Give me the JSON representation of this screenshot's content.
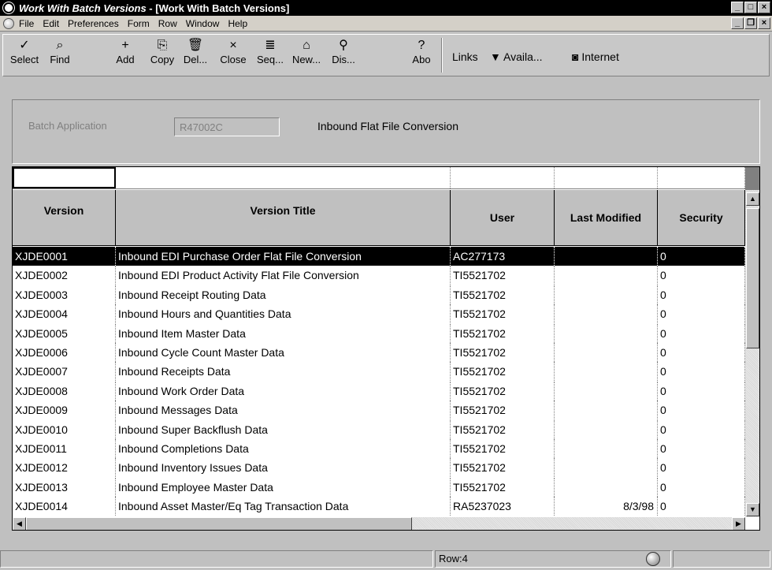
{
  "window": {
    "title_italic": "Work With Batch Versions",
    "title_rest": " - [Work With Batch Versions]"
  },
  "menu": [
    "File",
    "Edit",
    "Preferences",
    "Form",
    "Row",
    "Window",
    "Help"
  ],
  "toolbar": {
    "buttons": [
      {
        "label": "Select",
        "icon": "check-icon"
      },
      {
        "label": "Find",
        "icon": "find-icon"
      },
      {
        "label": "Add",
        "icon": "add-icon"
      },
      {
        "label": "Copy",
        "icon": "copy-icon"
      },
      {
        "label": "Del...",
        "icon": "delete-icon"
      },
      {
        "label": "Close",
        "icon": "close-icon"
      },
      {
        "label": "Seq...",
        "icon": "sequence-icon"
      },
      {
        "label": "New...",
        "icon": "new-icon"
      },
      {
        "label": "Dis...",
        "icon": "display-icon"
      },
      {
        "label": "Abo",
        "icon": "about-icon"
      }
    ],
    "links_label": "Links",
    "available_label": "Availa...",
    "internet_label": "Internet"
  },
  "form": {
    "batch_app_label": "Batch Application",
    "batch_app_value": "R47002C",
    "batch_app_desc": "Inbound Flat File Conversion"
  },
  "grid": {
    "headers": {
      "version": "Version",
      "title": "Version Title",
      "user": "User",
      "last_modified": "Last Modified",
      "security": "Security"
    },
    "rows": [
      {
        "version": "XJDE0001",
        "title": "Inbound EDI Purchase Order Flat File Conversion",
        "user": "AC277173",
        "last_modified": "",
        "security": "0"
      },
      {
        "version": "XJDE0002",
        "title": "Inbound EDI Product Activity Flat File Conversion",
        "user": "TI5521702",
        "last_modified": "",
        "security": "0"
      },
      {
        "version": "XJDE0003",
        "title": "Inbound Receipt Routing Data",
        "user": "TI5521702",
        "last_modified": "",
        "security": "0"
      },
      {
        "version": "XJDE0004",
        "title": "Inbound Hours and Quantities Data",
        "user": "TI5521702",
        "last_modified": "",
        "security": "0"
      },
      {
        "version": "XJDE0005",
        "title": "Inbound Item Master Data",
        "user": "TI5521702",
        "last_modified": "",
        "security": "0"
      },
      {
        "version": "XJDE0006",
        "title": "Inbound Cycle Count Master Data",
        "user": "TI5521702",
        "last_modified": "",
        "security": "0"
      },
      {
        "version": "XJDE0007",
        "title": "Inbound Receipts Data",
        "user": "TI5521702",
        "last_modified": "",
        "security": "0"
      },
      {
        "version": "XJDE0008",
        "title": "Inbound Work Order Data",
        "user": "TI5521702",
        "last_modified": "",
        "security": "0"
      },
      {
        "version": "XJDE0009",
        "title": "Inbound Messages Data",
        "user": "TI5521702",
        "last_modified": "",
        "security": "0"
      },
      {
        "version": "XJDE0010",
        "title": "Inbound Super Backflush Data",
        "user": "TI5521702",
        "last_modified": "",
        "security": "0"
      },
      {
        "version": "XJDE0011",
        "title": "Inbound Completions Data",
        "user": "TI5521702",
        "last_modified": "",
        "security": "0"
      },
      {
        "version": "XJDE0012",
        "title": "Inbound Inventory Issues Data",
        "user": "TI5521702",
        "last_modified": "",
        "security": "0"
      },
      {
        "version": "XJDE0013",
        "title": "Inbound Employee Master Data",
        "user": "TI5521702",
        "last_modified": "",
        "security": "0"
      },
      {
        "version": "XJDE0014",
        "title": "Inbound Asset Master/Eq Tag Transaction Data",
        "user": "RA5237023",
        "last_modified": "8/3/98",
        "security": "0"
      }
    ],
    "selected_index": 0
  },
  "status": {
    "row_text": "Row:4"
  }
}
